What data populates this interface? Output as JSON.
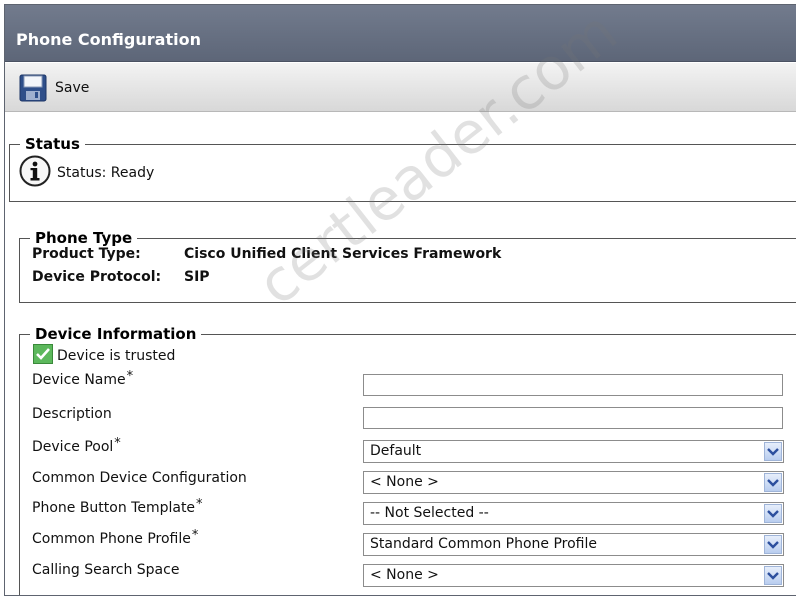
{
  "title": "Phone Configuration",
  "toolbar": {
    "save_label": "Save"
  },
  "status": {
    "legend": "Status",
    "text": "Status: Ready"
  },
  "phone_type": {
    "legend": "Phone Type",
    "product_label": "Product Type:",
    "product_value": "Cisco Unified Client Services Framework",
    "protocol_label": "Device Protocol:",
    "protocol_value": "SIP"
  },
  "device_info": {
    "legend": "Device Information",
    "trusted_label": "Device is trusted",
    "fields": {
      "device_name": {
        "label": "Device Name",
        "req": "*",
        "value": ""
      },
      "description": {
        "label": "Description",
        "value": ""
      },
      "device_pool": {
        "label": "Device Pool",
        "req": "*",
        "value": "Default"
      },
      "common_device_config": {
        "label": "Common Device Configuration",
        "value": "< None >"
      },
      "phone_button_template": {
        "label": "Phone Button Template",
        "req": "*",
        "value": "-- Not Selected --"
      },
      "common_phone_profile": {
        "label": "Common Phone Profile",
        "req": "*",
        "value": "Standard Common Phone Profile"
      },
      "calling_search_space": {
        "label": "Calling Search Space",
        "value": "< None >"
      }
    }
  },
  "watermark": "certleader.com",
  "colors": {
    "titlebar": "#6a7385",
    "dropdown_arrow": "#2c4f9e",
    "check": "#3aa33a"
  }
}
